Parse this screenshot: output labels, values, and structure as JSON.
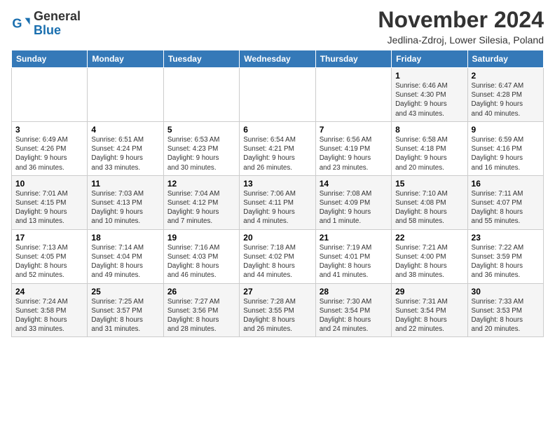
{
  "header": {
    "logo_general": "General",
    "logo_blue": "Blue",
    "month_title": "November 2024",
    "location": "Jedlina-Zdroj, Lower Silesia, Poland"
  },
  "days_of_week": [
    "Sunday",
    "Monday",
    "Tuesday",
    "Wednesday",
    "Thursday",
    "Friday",
    "Saturday"
  ],
  "weeks": [
    [
      {
        "day": "",
        "info": ""
      },
      {
        "day": "",
        "info": ""
      },
      {
        "day": "",
        "info": ""
      },
      {
        "day": "",
        "info": ""
      },
      {
        "day": "",
        "info": ""
      },
      {
        "day": "1",
        "info": "Sunrise: 6:46 AM\nSunset: 4:30 PM\nDaylight: 9 hours\nand 43 minutes."
      },
      {
        "day": "2",
        "info": "Sunrise: 6:47 AM\nSunset: 4:28 PM\nDaylight: 9 hours\nand 40 minutes."
      }
    ],
    [
      {
        "day": "3",
        "info": "Sunrise: 6:49 AM\nSunset: 4:26 PM\nDaylight: 9 hours\nand 36 minutes."
      },
      {
        "day": "4",
        "info": "Sunrise: 6:51 AM\nSunset: 4:24 PM\nDaylight: 9 hours\nand 33 minutes."
      },
      {
        "day": "5",
        "info": "Sunrise: 6:53 AM\nSunset: 4:23 PM\nDaylight: 9 hours\nand 30 minutes."
      },
      {
        "day": "6",
        "info": "Sunrise: 6:54 AM\nSunset: 4:21 PM\nDaylight: 9 hours\nand 26 minutes."
      },
      {
        "day": "7",
        "info": "Sunrise: 6:56 AM\nSunset: 4:19 PM\nDaylight: 9 hours\nand 23 minutes."
      },
      {
        "day": "8",
        "info": "Sunrise: 6:58 AM\nSunset: 4:18 PM\nDaylight: 9 hours\nand 20 minutes."
      },
      {
        "day": "9",
        "info": "Sunrise: 6:59 AM\nSunset: 4:16 PM\nDaylight: 9 hours\nand 16 minutes."
      }
    ],
    [
      {
        "day": "10",
        "info": "Sunrise: 7:01 AM\nSunset: 4:15 PM\nDaylight: 9 hours\nand 13 minutes."
      },
      {
        "day": "11",
        "info": "Sunrise: 7:03 AM\nSunset: 4:13 PM\nDaylight: 9 hours\nand 10 minutes."
      },
      {
        "day": "12",
        "info": "Sunrise: 7:04 AM\nSunset: 4:12 PM\nDaylight: 9 hours\nand 7 minutes."
      },
      {
        "day": "13",
        "info": "Sunrise: 7:06 AM\nSunset: 4:11 PM\nDaylight: 9 hours\nand 4 minutes."
      },
      {
        "day": "14",
        "info": "Sunrise: 7:08 AM\nSunset: 4:09 PM\nDaylight: 9 hours\nand 1 minute."
      },
      {
        "day": "15",
        "info": "Sunrise: 7:10 AM\nSunset: 4:08 PM\nDaylight: 8 hours\nand 58 minutes."
      },
      {
        "day": "16",
        "info": "Sunrise: 7:11 AM\nSunset: 4:07 PM\nDaylight: 8 hours\nand 55 minutes."
      }
    ],
    [
      {
        "day": "17",
        "info": "Sunrise: 7:13 AM\nSunset: 4:05 PM\nDaylight: 8 hours\nand 52 minutes."
      },
      {
        "day": "18",
        "info": "Sunrise: 7:14 AM\nSunset: 4:04 PM\nDaylight: 8 hours\nand 49 minutes."
      },
      {
        "day": "19",
        "info": "Sunrise: 7:16 AM\nSunset: 4:03 PM\nDaylight: 8 hours\nand 46 minutes."
      },
      {
        "day": "20",
        "info": "Sunrise: 7:18 AM\nSunset: 4:02 PM\nDaylight: 8 hours\nand 44 minutes."
      },
      {
        "day": "21",
        "info": "Sunrise: 7:19 AM\nSunset: 4:01 PM\nDaylight: 8 hours\nand 41 minutes."
      },
      {
        "day": "22",
        "info": "Sunrise: 7:21 AM\nSunset: 4:00 PM\nDaylight: 8 hours\nand 38 minutes."
      },
      {
        "day": "23",
        "info": "Sunrise: 7:22 AM\nSunset: 3:59 PM\nDaylight: 8 hours\nand 36 minutes."
      }
    ],
    [
      {
        "day": "24",
        "info": "Sunrise: 7:24 AM\nSunset: 3:58 PM\nDaylight: 8 hours\nand 33 minutes."
      },
      {
        "day": "25",
        "info": "Sunrise: 7:25 AM\nSunset: 3:57 PM\nDaylight: 8 hours\nand 31 minutes."
      },
      {
        "day": "26",
        "info": "Sunrise: 7:27 AM\nSunset: 3:56 PM\nDaylight: 8 hours\nand 28 minutes."
      },
      {
        "day": "27",
        "info": "Sunrise: 7:28 AM\nSunset: 3:55 PM\nDaylight: 8 hours\nand 26 minutes."
      },
      {
        "day": "28",
        "info": "Sunrise: 7:30 AM\nSunset: 3:54 PM\nDaylight: 8 hours\nand 24 minutes."
      },
      {
        "day": "29",
        "info": "Sunrise: 7:31 AM\nSunset: 3:54 PM\nDaylight: 8 hours\nand 22 minutes."
      },
      {
        "day": "30",
        "info": "Sunrise: 7:33 AM\nSunset: 3:53 PM\nDaylight: 8 hours\nand 20 minutes."
      }
    ]
  ]
}
